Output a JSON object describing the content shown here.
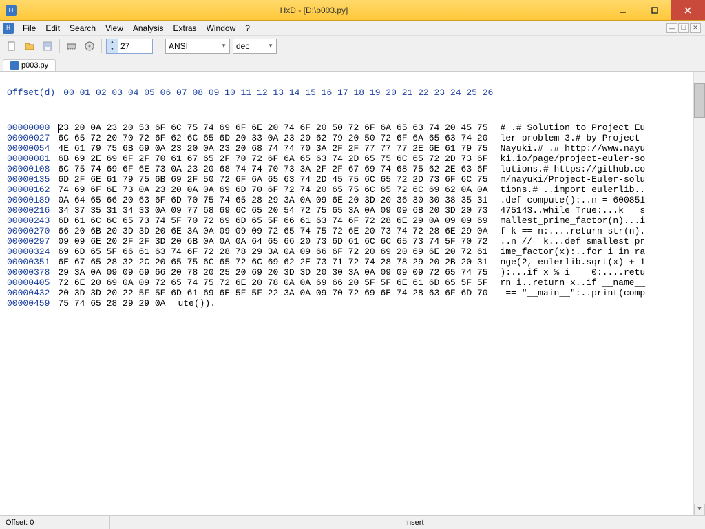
{
  "title": "HxD - [D:\\p003.py]",
  "menu": [
    "File",
    "Edit",
    "Search",
    "View",
    "Analysis",
    "Extras",
    "Window",
    "?"
  ],
  "toolbar": {
    "bytes_per_row": "27",
    "encoding": "ANSI",
    "radix": "dec"
  },
  "tab": {
    "label": "p003.py"
  },
  "hex": {
    "offset_header": "Offset(d)",
    "col_header": "00 01 02 03 04 05 06 07 08 09 10 11 12 13 14 15 16 17 18 19 20 21 22 23 24 25 26",
    "rows": [
      {
        "off": "00000000",
        "hex": "23 20 0A 23 20 53 6F 6C 75 74 69 6F 6E 20 74 6F 20 50 72 6F 6A 65 63 74 20 45 75",
        "asc": "# .# Solution to Project Eu"
      },
      {
        "off": "00000027",
        "hex": "6C 65 72 20 70 72 6F 62 6C 65 6D 20 33 0A 23 20 62 79 20 50 72 6F 6A 65 63 74 20",
        "asc": "ler problem 3.# by Project "
      },
      {
        "off": "00000054",
        "hex": "4E 61 79 75 6B 69 0A 23 20 0A 23 20 68 74 74 70 3A 2F 2F 77 77 77 2E 6E 61 79 75",
        "asc": "Nayuki.# .# http://www.nayu"
      },
      {
        "off": "00000081",
        "hex": "6B 69 2E 69 6F 2F 70 61 67 65 2F 70 72 6F 6A 65 63 74 2D 65 75 6C 65 72 2D 73 6F",
        "asc": "ki.io/page/project-euler-so"
      },
      {
        "off": "00000108",
        "hex": "6C 75 74 69 6F 6E 73 0A 23 20 68 74 74 70 73 3A 2F 2F 67 69 74 68 75 62 2E 63 6F",
        "asc": "lutions.# https://github.co"
      },
      {
        "off": "00000135",
        "hex": "6D 2F 6E 61 79 75 6B 69 2F 50 72 6F 6A 65 63 74 2D 45 75 6C 65 72 2D 73 6F 6C 75",
        "asc": "m/nayuki/Project-Euler-solu"
      },
      {
        "off": "00000162",
        "hex": "74 69 6F 6E 73 0A 23 20 0A 0A 69 6D 70 6F 72 74 20 65 75 6C 65 72 6C 69 62 0A 0A",
        "asc": "tions.# ..import eulerlib.."
      },
      {
        "off": "00000189",
        "hex": "0A 64 65 66 20 63 6F 6D 70 75 74 65 28 29 3A 0A 09 6E 20 3D 20 36 30 30 38 35 31",
        "asc": ".def compute():..n = 600851"
      },
      {
        "off": "00000216",
        "hex": "34 37 35 31 34 33 0A 09 77 68 69 6C 65 20 54 72 75 65 3A 0A 09 09 6B 20 3D 20 73",
        "asc": "475143..while True:...k = s"
      },
      {
        "off": "00000243",
        "hex": "6D 61 6C 6C 65 73 74 5F 70 72 69 6D 65 5F 66 61 63 74 6F 72 28 6E 29 0A 09 09 69",
        "asc": "mallest_prime_factor(n)...i"
      },
      {
        "off": "00000270",
        "hex": "66 20 6B 20 3D 3D 20 6E 3A 0A 09 09 09 72 65 74 75 72 6E 20 73 74 72 28 6E 29 0A",
        "asc": "f k == n:....return str(n)."
      },
      {
        "off": "00000297",
        "hex": "09 09 6E 20 2F 2F 3D 20 6B 0A 0A 0A 64 65 66 20 73 6D 61 6C 6C 65 73 74 5F 70 72",
        "asc": "..n //= k...def smallest_pr"
      },
      {
        "off": "00000324",
        "hex": "69 6D 65 5F 66 61 63 74 6F 72 28 78 29 3A 0A 09 66 6F 72 20 69 20 69 6E 20 72 61",
        "asc": "ime_factor(x):..for i in ra"
      },
      {
        "off": "00000351",
        "hex": "6E 67 65 28 32 2C 20 65 75 6C 65 72 6C 69 62 2E 73 71 72 74 28 78 29 20 2B 20 31",
        "asc": "nge(2, eulerlib.sqrt(x) + 1"
      },
      {
        "off": "00000378",
        "hex": "29 3A 0A 09 09 69 66 20 78 20 25 20 69 20 3D 3D 20 30 3A 0A 09 09 09 72 65 74 75",
        "asc": "):...if x % i == 0:....retu"
      },
      {
        "off": "00000405",
        "hex": "72 6E 20 69 0A 09 72 65 74 75 72 6E 20 78 0A 0A 69 66 20 5F 5F 6E 61 6D 65 5F 5F",
        "asc": "rn i..return x..if __name__"
      },
      {
        "off": "00000432",
        "hex": "20 3D 3D 20 22 5F 5F 6D 61 69 6E 5F 5F 22 3A 0A 09 70 72 69 6E 74 28 63 6F 6D 70",
        "asc": " == \"__main__\":..print(comp"
      },
      {
        "off": "00000459",
        "hex": "75 74 65 28 29 29 0A",
        "asc": "ute())."
      }
    ]
  },
  "status": {
    "offset": "Offset: 0",
    "mode": "Insert"
  }
}
